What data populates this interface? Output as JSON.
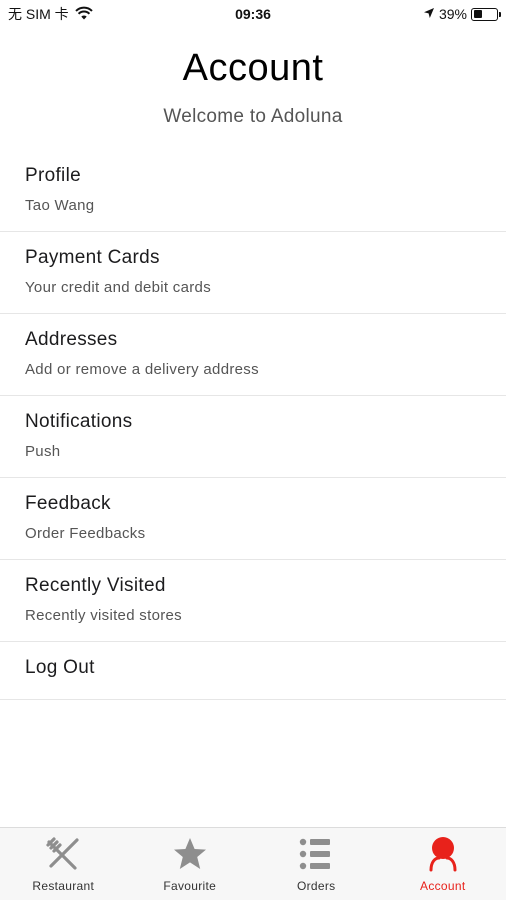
{
  "status_bar": {
    "carrier": "无 SIM 卡",
    "time": "09:36",
    "battery_percent_label": "39%",
    "battery_level": 0.39,
    "icons": [
      "wifi-icon",
      "location-arrow-icon",
      "battery-icon"
    ]
  },
  "header": {
    "title": "Account",
    "subtitle": "Welcome to Adoluna"
  },
  "menu": {
    "items": [
      {
        "title": "Profile",
        "subtitle": "Tao Wang"
      },
      {
        "title": "Payment Cards",
        "subtitle": "Your credit and debit cards"
      },
      {
        "title": "Addresses",
        "subtitle": "Add or remove a delivery address"
      },
      {
        "title": "Notifications",
        "subtitle": "Push"
      },
      {
        "title": "Feedback",
        "subtitle": "Order Feedbacks"
      },
      {
        "title": "Recently Visited",
        "subtitle": "Recently visited stores"
      },
      {
        "title": "Log Out"
      }
    ]
  },
  "tab_bar": {
    "tabs": [
      {
        "label": "Restaurant",
        "icon": "fork-knife-icon"
      },
      {
        "label": "Favourite",
        "icon": "star-icon"
      },
      {
        "label": "Orders",
        "icon": "list-icon"
      },
      {
        "label": "Account",
        "icon": "person-icon",
        "active": true
      }
    ],
    "active_color": "#e8221b",
    "inactive_color": "#8e8e8e"
  }
}
